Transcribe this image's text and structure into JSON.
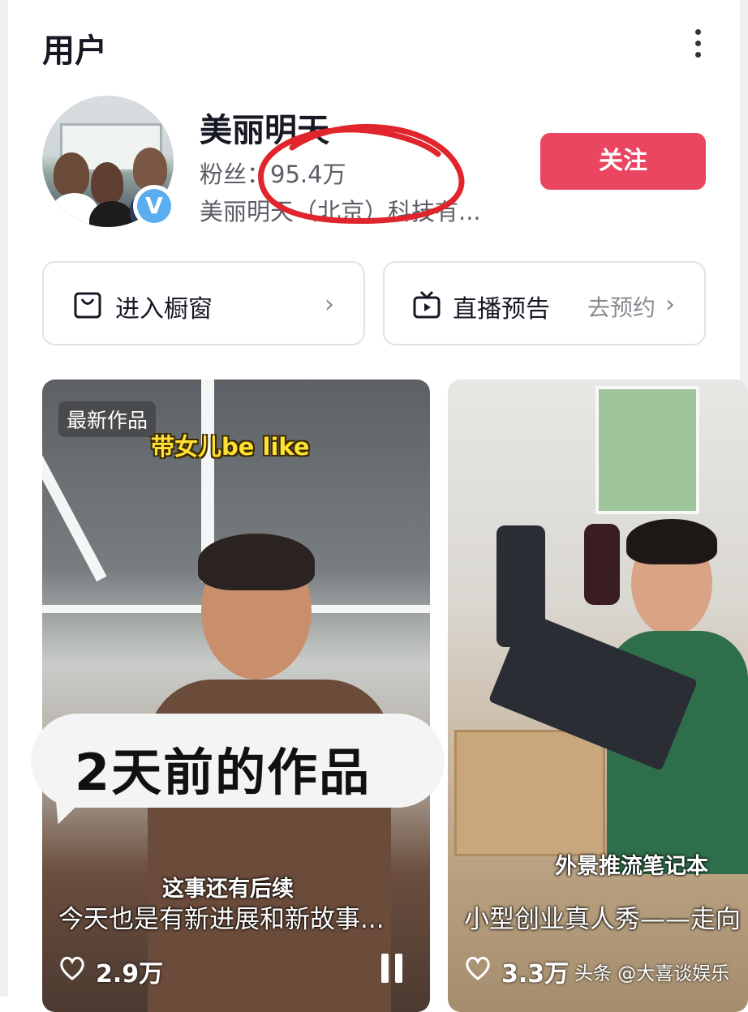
{
  "header": {
    "title": "用户",
    "more_icon": "more-vertical-icon"
  },
  "profile": {
    "name": "美丽明天",
    "fans_label": "粉丝：",
    "fans_count": "95.4万",
    "company": "美丽明天（北京）科技有...",
    "verified_badge": "V",
    "follow_button": "关注",
    "accent_color": "#ea4561"
  },
  "actions": {
    "shop": {
      "label": "进入橱窗",
      "icon": "shopping-bag-icon"
    },
    "live": {
      "label": "直播预告",
      "sub": "去预约",
      "icon": "tv-icon"
    }
  },
  "videos": [
    {
      "badge": "最新作品",
      "caption_top": "带女儿be like",
      "bubble": "2天前的作品",
      "caption": "这事还有后续",
      "title": "今天也是有新进展和新故事...",
      "likes": "2.9万"
    },
    {
      "caption": "外景推流笔记本",
      "title": "小型创业真人秀——走向",
      "likes": "3.3万"
    }
  ],
  "watermark": "头条 @大喜谈娱乐"
}
